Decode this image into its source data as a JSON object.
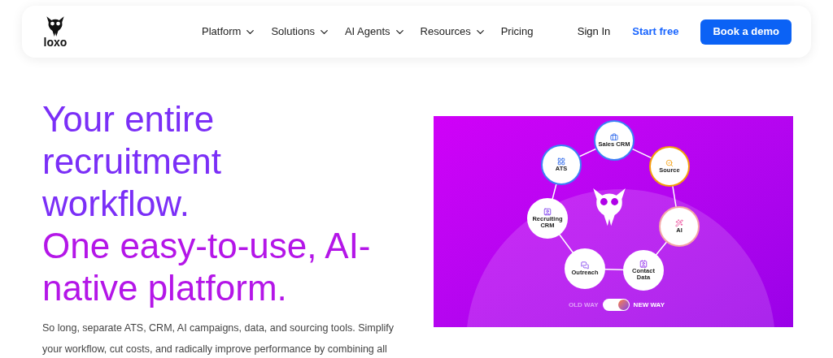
{
  "nav": {
    "logo": "loxo",
    "menu": [
      {
        "label": "Platform",
        "dropdown": true
      },
      {
        "label": "Solutions",
        "dropdown": true
      },
      {
        "label": "AI Agents",
        "dropdown": true
      },
      {
        "label": "Resources",
        "dropdown": true
      },
      {
        "label": "Pricing",
        "dropdown": false
      }
    ],
    "sign_in": "Sign In",
    "start_free": "Start free",
    "cta": "Book a demo"
  },
  "hero": {
    "headline_1": "Your entire recruitment workflow.",
    "headline_2": "One easy-to-use, AI-native platform.",
    "body": "So long, separate ATS, CRM, AI campaigns, data, and sourcing tools. Simplify your workflow, cut costs, and radically improve performance by combining all"
  },
  "diagram": {
    "nodes": [
      {
        "label": "Sales CRM",
        "color": "#3b82f6"
      },
      {
        "label": "ATS",
        "color": "#3b82f6"
      },
      {
        "label": "Source",
        "color": "#f59e0b"
      },
      {
        "label": "Recruiting CRM",
        "color": "#ffffff"
      },
      {
        "label": "AI",
        "color": "#f4a6a6"
      },
      {
        "label": "Outreach",
        "color": "#ffffff"
      },
      {
        "label": "Contact Data",
        "color": "#ffffff"
      }
    ],
    "toggle": {
      "off_label": "OLD WAY",
      "on_label": "NEW WAY",
      "on": true
    }
  }
}
